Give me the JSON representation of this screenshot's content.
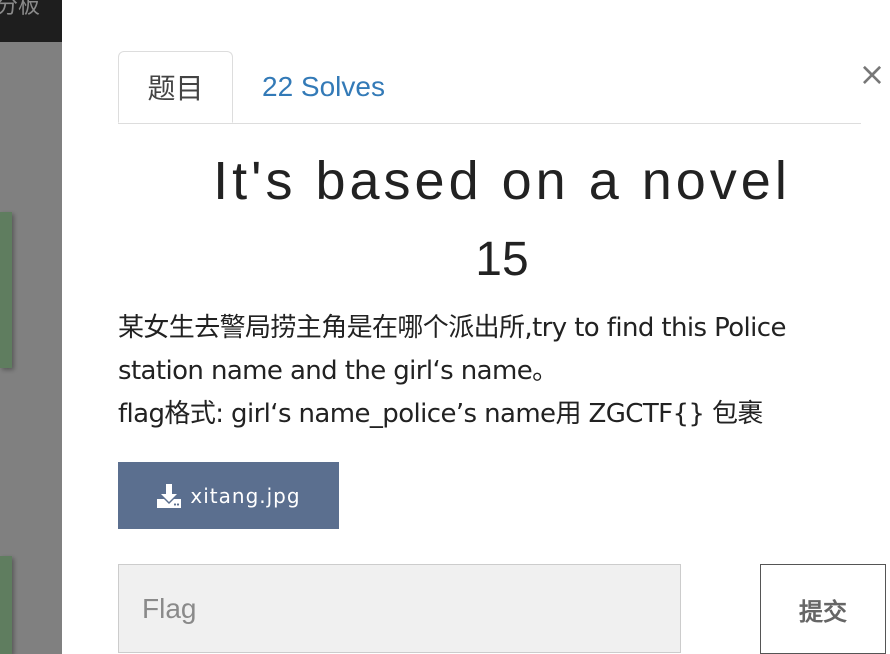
{
  "backdrop": {
    "topbar_text": "分板"
  },
  "modal": {
    "close_label": "×",
    "tabs": [
      {
        "label": "题目"
      },
      {
        "label": "22 Solves"
      }
    ],
    "challenge": {
      "title": "It's based on a novel",
      "points": "15",
      "description": [
        "某女生去警局捞主角是在哪个派出所,try to find this Police station name and the girl‘s name。",
        "flag格式: girl‘s name_police’s name用 ZGCTF{} 包裹"
      ],
      "file": {
        "label": "xitang.jpg",
        "icon": "download-icon"
      }
    },
    "flag_input": {
      "placeholder": "Flag",
      "value": ""
    },
    "submit_label": "提交"
  },
  "colors": {
    "link": "#337ab7",
    "download_button": "#5b6f8f",
    "input_background": "#f0f0f0"
  }
}
